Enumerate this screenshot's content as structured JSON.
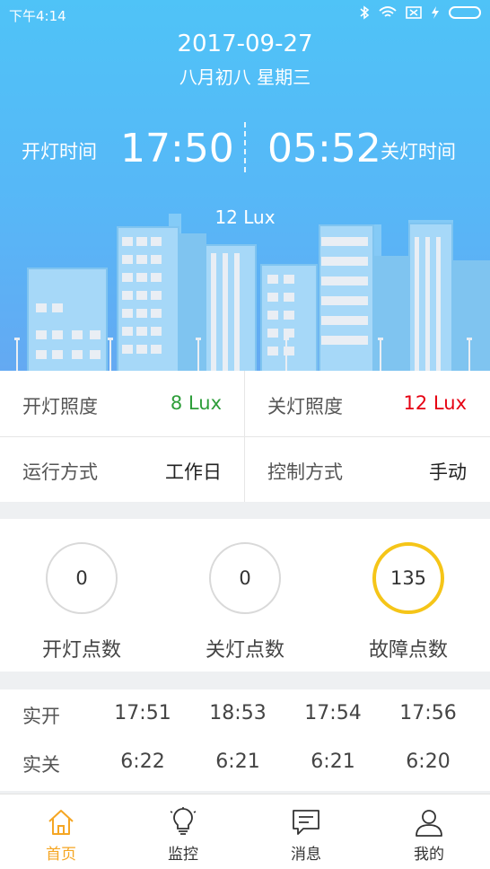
{
  "status_bar": {
    "time": "下午4:14"
  },
  "header": {
    "date": "2017-09-27",
    "lunar": "八月初八 星期三",
    "on_label": "开灯时间",
    "on_time": "17:50",
    "off_time": "05:52",
    "off_label": "关灯时间",
    "lux_now": "12 Lux"
  },
  "info": {
    "on_illum_label": "开灯照度",
    "on_illum_value": "8 Lux",
    "off_illum_label": "关灯照度",
    "off_illum_value": "12 Lux",
    "run_mode_label": "运行方式",
    "run_mode_value": "工作日",
    "control_label": "控制方式",
    "control_value": "手动"
  },
  "counts": [
    {
      "value": "0",
      "label": "开灯点数"
    },
    {
      "value": "0",
      "label": "关灯点数"
    },
    {
      "value": "135",
      "label": "故障点数"
    }
  ],
  "times": {
    "on_header": "实开",
    "on": [
      "17:51",
      "18:53",
      "17:54",
      "17:56"
    ],
    "off_header": "实关",
    "off": [
      "6:22",
      "6:21",
      "6:21",
      "6:20"
    ]
  },
  "tabs": [
    {
      "label": "首页",
      "icon": "home-icon",
      "active": true
    },
    {
      "label": "监控",
      "icon": "bulb-icon",
      "active": false
    },
    {
      "label": "消息",
      "icon": "message-icon",
      "active": false
    },
    {
      "label": "我的",
      "icon": "user-icon",
      "active": false
    }
  ],
  "colors": {
    "accent": "#f5a623",
    "on_lux": "#2e9e3a",
    "off_lux": "#e60012",
    "fault_ring": "#f5c518"
  }
}
